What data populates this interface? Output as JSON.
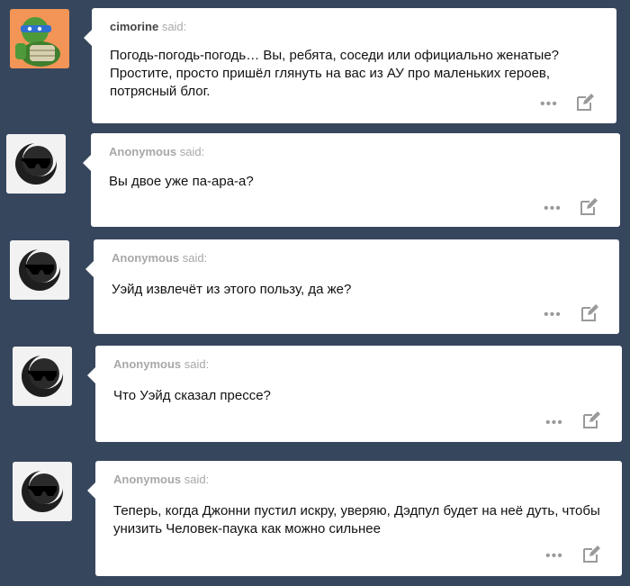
{
  "said_word": "said:",
  "more_glyph": "•••",
  "icons": {
    "more": "more-dots-icon",
    "edit": "edit-pencil-icon",
    "anon_avatar": "sunglasses-moon-avatar",
    "user_avatar": "turtle-avatar"
  },
  "colors": {
    "background": "#36465d",
    "card": "#ffffff",
    "said": "#a8a8a8",
    "text": "#111111"
  },
  "asks": [
    {
      "asker": "cimorine",
      "question": "Погодь-погодь-погодь… Вы, ребята, соседи или официально женатые? Простите, просто пришёл глянуть на вас из АУ про маленьких героев, потрясный блог."
    },
    {
      "asker": "Anonymous",
      "question": "Вы двое уже па-ара-а?"
    },
    {
      "asker": "Anonymous",
      "question": "Уэйд извлечёт из этого пользу, да же?"
    },
    {
      "asker": "Anonymous",
      "question": "Что Уэйд сказал прессе?"
    },
    {
      "asker": "Anonymous",
      "question": "Теперь, когда Джонни пустил искру, уверяю, Дэдпул будет на неё дуть, чтобы унизить Человек-паука как можно сильнее"
    }
  ]
}
